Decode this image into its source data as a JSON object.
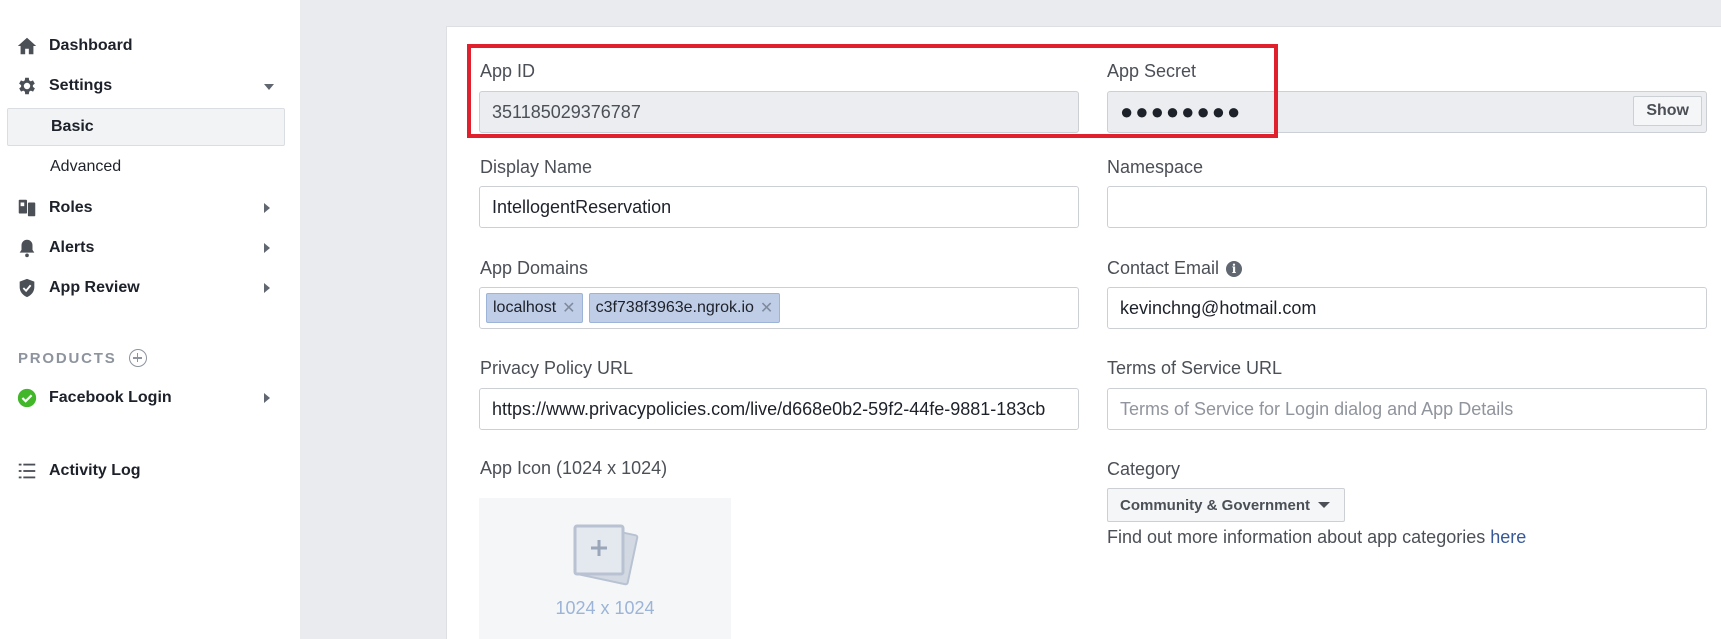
{
  "sidebar": {
    "dashboard": {
      "label": "Dashboard",
      "icon": "home-icon"
    },
    "settings": {
      "label": "Settings",
      "icon": "gear-icon",
      "subitems": [
        {
          "label": "Basic",
          "active": true
        },
        {
          "label": "Advanced",
          "active": false
        }
      ]
    },
    "roles": {
      "label": "Roles",
      "icon": "roles-icon"
    },
    "alerts": {
      "label": "Alerts",
      "icon": "bell-icon"
    },
    "app_review": {
      "label": "App Review",
      "icon": "shield-check-icon"
    },
    "products_label": "PRODUCTS",
    "facebook_login": {
      "label": "Facebook Login",
      "icon": "check-circle-icon",
      "status_color": "#42b72a"
    },
    "activity_log": {
      "label": "Activity Log",
      "icon": "list-icon"
    }
  },
  "form": {
    "app_id": {
      "label": "App ID",
      "value": "351185029376787"
    },
    "app_secret": {
      "label": "App Secret",
      "value": "●●●●●●●●",
      "show_label": "Show"
    },
    "display_name": {
      "label": "Display Name",
      "value": "IntellogentReservation"
    },
    "namespace": {
      "label": "Namespace",
      "value": ""
    },
    "app_domains": {
      "label": "App Domains",
      "tokens": [
        "localhost",
        "c3f738f3963e.ngrok.io"
      ]
    },
    "contact_email": {
      "label": "Contact Email",
      "value": "kevinchng@hotmail.com"
    },
    "privacy_policy_url": {
      "label": "Privacy Policy URL",
      "value": "https://www.privacypolicies.com/live/d668e0b2-59f2-44fe-9881-183cb"
    },
    "terms_of_service_url": {
      "label": "Terms of Service URL",
      "placeholder": "Terms of Service for Login dialog and App Details"
    },
    "app_icon": {
      "label": "App Icon (1024 x 1024)",
      "caption": "1024 x 1024"
    },
    "category": {
      "label": "Category",
      "selected": "Community & Government",
      "help_prefix": "Find out more information about app categories ",
      "help_link": "here"
    }
  },
  "colors": {
    "highlight_border": "#e0202d",
    "link": "#365899",
    "success": "#42b72a"
  }
}
